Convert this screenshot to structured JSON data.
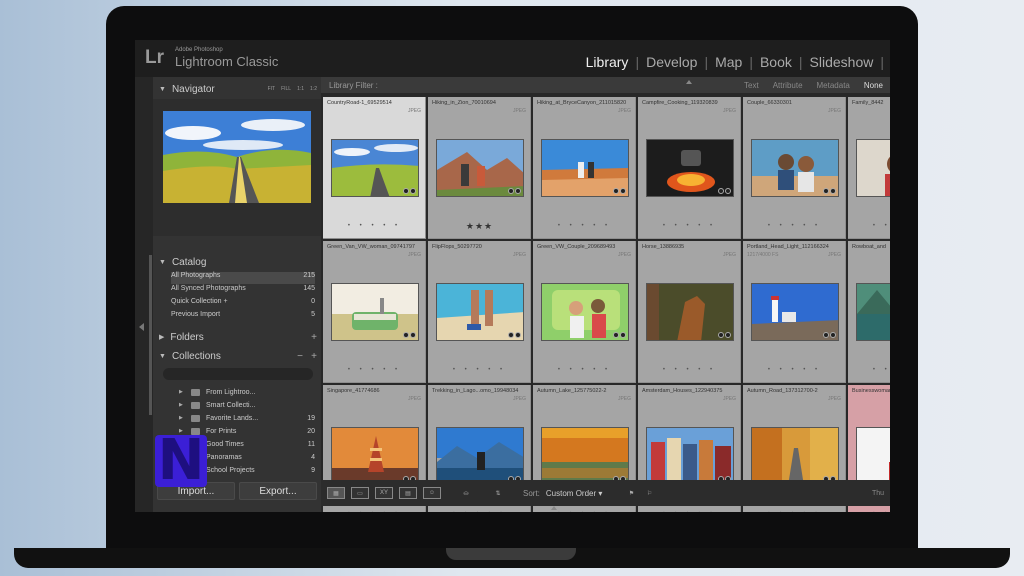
{
  "app": {
    "logo": "Lr",
    "brand_small": "Adobe Photoshop",
    "brand_name": "Lightroom Classic",
    "modules": [
      {
        "label": "Library",
        "active": true
      },
      {
        "label": "Develop",
        "active": false
      },
      {
        "label": "Map",
        "active": false
      },
      {
        "label": "Book",
        "active": false
      },
      {
        "label": "Slideshow",
        "active": false
      }
    ]
  },
  "navigator": {
    "title": "Navigator",
    "modes": [
      "FIT",
      "FILL",
      "1:1",
      "1:2"
    ]
  },
  "catalog": {
    "title": "Catalog",
    "items": [
      {
        "label": "All Photographs",
        "count": "215"
      },
      {
        "label": "All Synced Photographs",
        "count": "145"
      },
      {
        "label": "Quick Collection +",
        "count": "0"
      },
      {
        "label": "Previous Import",
        "count": "5"
      }
    ]
  },
  "folders": {
    "title": "Folders"
  },
  "collections": {
    "title": "Collections",
    "items": [
      {
        "label": "From Lightroo...",
        "count": ""
      },
      {
        "label": "Smart Collecti...",
        "count": ""
      },
      {
        "label": "Favorite Lands...",
        "count": "19"
      },
      {
        "label": "For Prints",
        "count": "20"
      },
      {
        "label": "Good Times",
        "count": "11"
      },
      {
        "label": "Panoramas",
        "count": "4"
      },
      {
        "label": "School Projects",
        "count": "9"
      }
    ]
  },
  "buttons": {
    "import": "Import...",
    "export": "Export..."
  },
  "filter": {
    "label": "Library Filter :",
    "options": [
      {
        "label": "Text",
        "selected": false
      },
      {
        "label": "Attribute",
        "selected": false
      },
      {
        "label": "Metadata",
        "selected": false
      },
      {
        "label": "None",
        "selected": true
      }
    ]
  },
  "grid": {
    "rows": [
      [
        {
          "name": "CountryRoad-1_69529514",
          "sub": "",
          "fmt": "JPEG",
          "stars": "",
          "selected": true,
          "scene": "road"
        },
        {
          "name": "Hiking_in_Zion_70010694",
          "sub": "",
          "fmt": "JPEG",
          "stars": "★★★",
          "selected": false,
          "scene": "hike"
        },
        {
          "name": "Hiking_at_BryceCanyon_211015820",
          "sub": "",
          "fmt": "JPEG",
          "stars": "",
          "selected": false,
          "scene": "canyon"
        },
        {
          "name": "Campfire_Cooking_119320839",
          "sub": "",
          "fmt": "JPEG",
          "stars": "",
          "selected": false,
          "scene": "fire"
        },
        {
          "name": "Couple_66330301",
          "sub": "",
          "fmt": "JPEG",
          "stars": "",
          "selected": false,
          "scene": "couple"
        },
        {
          "name": "Family_8442",
          "sub": "",
          "fmt": "",
          "stars": "",
          "selected": false,
          "scene": "family"
        }
      ],
      [
        {
          "name": "Green_Van_VW_woman_09741797",
          "sub": "",
          "fmt": "JPEG",
          "stars": "",
          "selected": false,
          "scene": "van"
        },
        {
          "name": "FlipFlops_50297720",
          "sub": "",
          "fmt": "JPEG",
          "stars": "",
          "selected": false,
          "scene": "beach"
        },
        {
          "name": "Green_VW_Couple_209689493",
          "sub": "",
          "fmt": "JPEG",
          "stars": "",
          "selected": false,
          "scene": "vwcouple"
        },
        {
          "name": "Horse_13886935",
          "sub": "",
          "fmt": "JPEG",
          "stars": "",
          "selected": false,
          "scene": "horse"
        },
        {
          "name": "Portland_Head_Light_112166324",
          "sub": "1217/4000 FS",
          "fmt": "JPEG",
          "stars": "",
          "selected": false,
          "scene": "lighthouse"
        },
        {
          "name": "Rowboat_and",
          "sub": "",
          "fmt": "",
          "stars": "",
          "selected": false,
          "scene": "lake"
        }
      ],
      [
        {
          "name": "Singapore_41774686",
          "sub": "",
          "fmt": "JPEG",
          "stars": "",
          "selected": false,
          "scene": "singapore"
        },
        {
          "name": "Trekking_in_Lago...omo_19948034",
          "sub": "",
          "fmt": "JPEG",
          "stars": "",
          "selected": false,
          "scene": "trek"
        },
        {
          "name": "Autumn_Lake_125775022-2",
          "sub": "",
          "fmt": "JPEG",
          "stars": "",
          "selected": false,
          "scene": "autumn"
        },
        {
          "name": "Amsterdam_Houses_122940375",
          "sub": "",
          "fmt": "JPEG",
          "stars": "",
          "selected": false,
          "scene": "amsterdam"
        },
        {
          "name": "Autumn_Road_137312700-2",
          "sub": "",
          "fmt": "JPEG",
          "stars": "",
          "selected": false,
          "scene": "autumnroad"
        },
        {
          "name": "Businesswoman",
          "sub": "",
          "fmt": "",
          "stars": "",
          "selected": false,
          "scene": "business"
        }
      ]
    ]
  },
  "toolbar": {
    "sort_label": "Sort:",
    "sort_value": "Custom Order",
    "right_label": "Thu"
  },
  "overlay_logo": "N"
}
